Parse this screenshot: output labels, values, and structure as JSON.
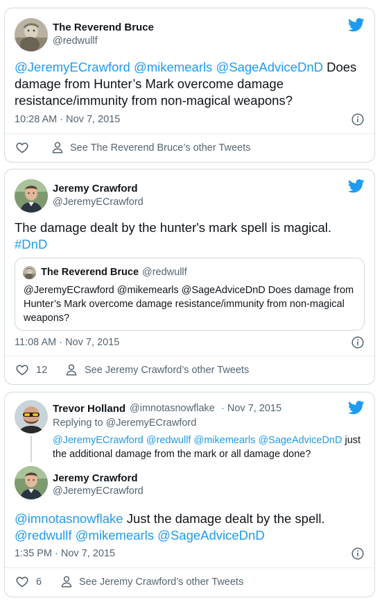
{
  "tweet1": {
    "author_name": "The Reverend Bruce",
    "author_handle": "@redwullf",
    "text_mentions": "@JeremyECrawford @mikemearls @SageAdviceDnD",
    "text_body": " Does damage from Hunter’s Mark overcome damage resistance/immunity from non-magical weapons?",
    "timestamp": "10:28 AM · Nov 7, 2015",
    "footer_link": "See The Reverend Bruce’s other Tweets"
  },
  "tweet2": {
    "author_name": "Jeremy Crawford",
    "author_handle": "@JeremyECrawford",
    "text_body": "The damage dealt by the hunter's mark spell is magical. ",
    "text_hashtag": "#DnD",
    "quote": {
      "author_name": "The Reverend Bruce",
      "author_handle": "@redwullf",
      "text": "@JeremyECrawford @mikemearls @SageAdviceDnD Does damage from Hunter’s Mark overcome damage resistance/immunity from non-magical weapons?"
    },
    "timestamp": "11:08 AM · Nov 7, 2015",
    "like_count": "12",
    "footer_link": "See Jeremy Crawford’s other Tweets"
  },
  "tweet3": {
    "parent": {
      "author_name": "Trevor Holland",
      "author_handle": "@imnotasnowflake",
      "date": "· Nov 7, 2015",
      "replying_prefix": "Replying to ",
      "replying_to": "@JeremyECrawford",
      "text_mentions": "@JeremyECrawford @redwullf @mikemearls @SageAdviceDnD",
      "text_body": " just the additional damage from the mark or all damage done?"
    },
    "author_name": "Jeremy Crawford",
    "author_handle": "@JeremyECrawford",
    "text_mention_start": "@imnotasnowflake",
    "text_body": " Just the damage dealt by the spell. ",
    "text_mentions_end": "@redwullf @mikemearls @SageAdviceDnD",
    "timestamp": "1:35 PM · Nov 7, 2015",
    "like_count": "6",
    "footer_link": "See Jeremy Crawford’s other Tweets"
  },
  "icons": {
    "brand": "twitter-bird-icon",
    "info": "info-icon",
    "like": "heart-icon",
    "profile": "person-icon"
  },
  "colors": {
    "link": "#1d9bf0",
    "text": "#0f1419",
    "muted": "#536471",
    "border": "#cfd9de"
  }
}
